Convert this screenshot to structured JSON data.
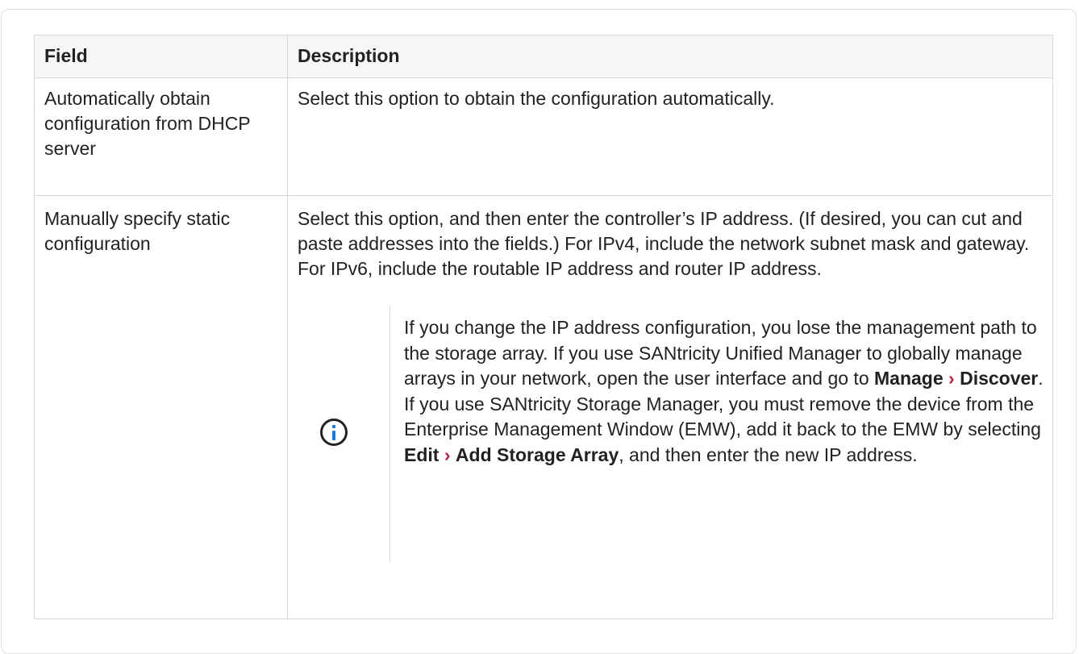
{
  "table": {
    "headers": [
      "Field",
      "Description"
    ],
    "rows": [
      {
        "field": "Automatically obtain configuration from DHCP server",
        "description": "Select this option to obtain the configuration automatically."
      },
      {
        "field": "Manually specify static configuration",
        "description": "Select this option, and then enter the controller’s IP address. (If desired, you can cut and paste addresses into the fields.) For IPv4, include the network subnet mask and gateway. For IPv6, include the routable IP address and router IP address."
      }
    ]
  },
  "note": {
    "icon": "info-circle-icon",
    "text_1": "If you change the IP address configuration, you lose the management path to the storage array. If you use SANtricity Unified Manager to globally manage arrays in your network, open the user interface and go to ",
    "menu_1_a": "Manage",
    "separator": "›",
    "menu_1_b": "Discover",
    "text_2": ". If you use SANtricity Storage Manager, you must remove the device from the Enterprise Management Window (EMW), add it back to the EMW by selecting ",
    "menu_2_a": "Edit",
    "menu_2_b": "Add Storage Array",
    "text_3": ", and then enter the new IP address."
  },
  "colors": {
    "menu_arrow": "#b0263f",
    "info_icon": "#1a7bd6",
    "header_bg": "#f6f6f6",
    "border": "#d8d8d8"
  }
}
